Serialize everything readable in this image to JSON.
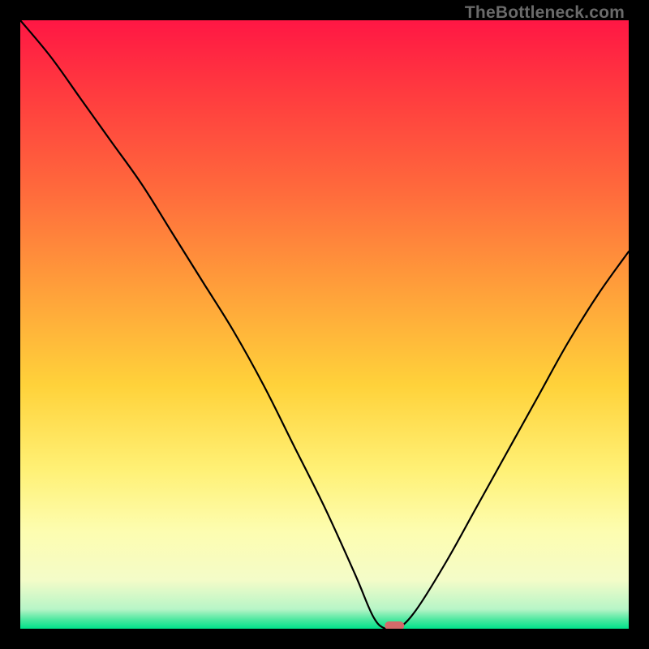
{
  "watermark": "TheBottleneck.com",
  "chart_data": {
    "type": "line",
    "title": "",
    "xlabel": "",
    "ylabel": "",
    "xlim": [
      0,
      100
    ],
    "ylim": [
      0,
      100
    ],
    "grid": false,
    "legend": false,
    "background_gradient": {
      "stops": [
        {
          "offset": 0.0,
          "color": "#ff1744"
        },
        {
          "offset": 0.12,
          "color": "#ff3b3f"
        },
        {
          "offset": 0.28,
          "color": "#ff6a3c"
        },
        {
          "offset": 0.45,
          "color": "#ffa23a"
        },
        {
          "offset": 0.6,
          "color": "#ffd23a"
        },
        {
          "offset": 0.74,
          "color": "#fff176"
        },
        {
          "offset": 0.84,
          "color": "#fdfdb0"
        },
        {
          "offset": 0.92,
          "color": "#f4fcc8"
        },
        {
          "offset": 0.968,
          "color": "#b7f5c7"
        },
        {
          "offset": 0.985,
          "color": "#4de8a0"
        },
        {
          "offset": 1.0,
          "color": "#00e28a"
        }
      ]
    },
    "series": [
      {
        "name": "bottleneck-curve",
        "color": "#000000",
        "x": [
          0,
          5,
          10,
          15,
          20,
          25,
          30,
          35,
          40,
          45,
          50,
          55,
          58,
          60,
          62,
          65,
          70,
          75,
          80,
          85,
          90,
          95,
          100
        ],
        "y": [
          100,
          94,
          87,
          80,
          73,
          65,
          57,
          49,
          40,
          30,
          20,
          9,
          2,
          0,
          0,
          3,
          11,
          20,
          29,
          38,
          47,
          55,
          62
        ]
      }
    ],
    "marker": {
      "name": "optimal-point",
      "x": 61.5,
      "y": 0.5,
      "width": 3.2,
      "height": 1.4,
      "color": "#d46a6a"
    }
  }
}
